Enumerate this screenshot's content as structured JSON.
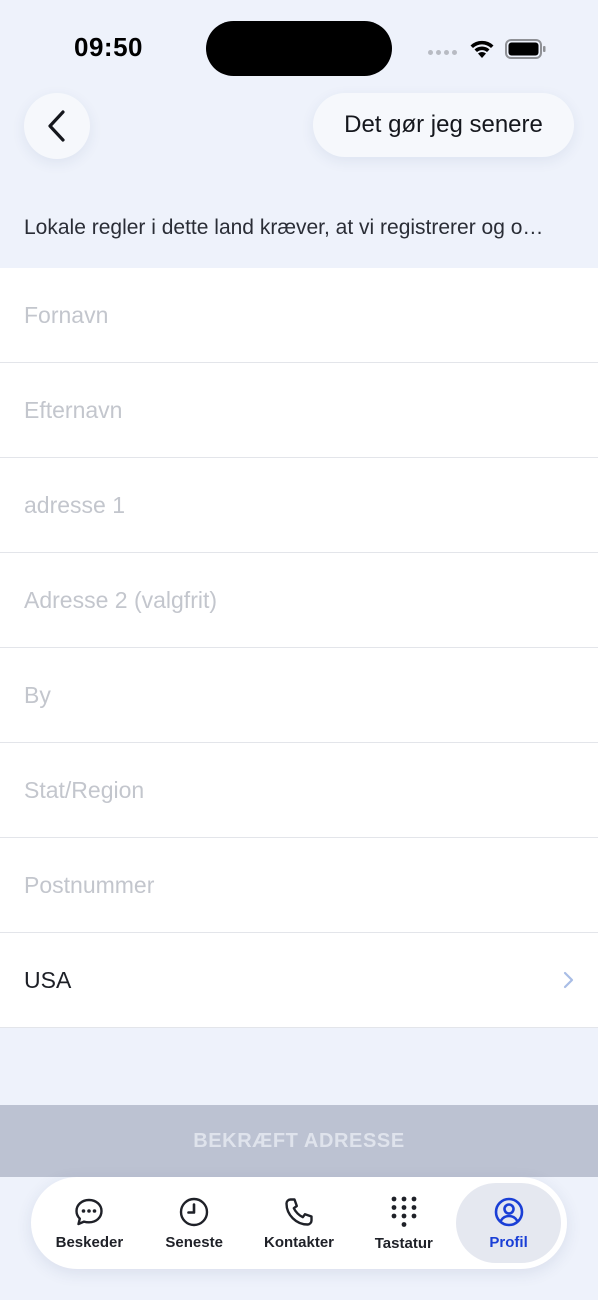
{
  "status": {
    "time": "09:50"
  },
  "header": {
    "later_label": "Det gør jeg senere"
  },
  "info_text": "Lokale regler i dette land kræver, at vi registrerer og o…",
  "form": {
    "first_name": {
      "placeholder": "Fornavn",
      "value": ""
    },
    "last_name": {
      "placeholder": "Efternavn",
      "value": ""
    },
    "address1": {
      "placeholder": "adresse 1",
      "value": ""
    },
    "address2": {
      "placeholder": "Adresse 2 (valgfrit)",
      "value": ""
    },
    "city": {
      "placeholder": "By",
      "value": ""
    },
    "state": {
      "placeholder": "Stat/Region",
      "value": ""
    },
    "postal": {
      "placeholder": "Postnummer",
      "value": ""
    },
    "country": {
      "value": "USA"
    }
  },
  "confirm_label": "BEKRÆFT ADRESSE",
  "tabs": [
    {
      "label": "Beskeder",
      "icon": "chat-bubble-icon",
      "active": false
    },
    {
      "label": "Seneste",
      "icon": "clock-icon",
      "active": false
    },
    {
      "label": "Kontakter",
      "icon": "phone-icon",
      "active": false
    },
    {
      "label": "Tastatur",
      "icon": "keypad-icon",
      "active": false
    },
    {
      "label": "Profil",
      "icon": "profile-icon",
      "active": true
    }
  ],
  "colors": {
    "background": "#eef2fb",
    "accent": "#1a3fd6",
    "confirm_disabled": "#bcc2d2",
    "placeholder": "#c3c6cd"
  }
}
